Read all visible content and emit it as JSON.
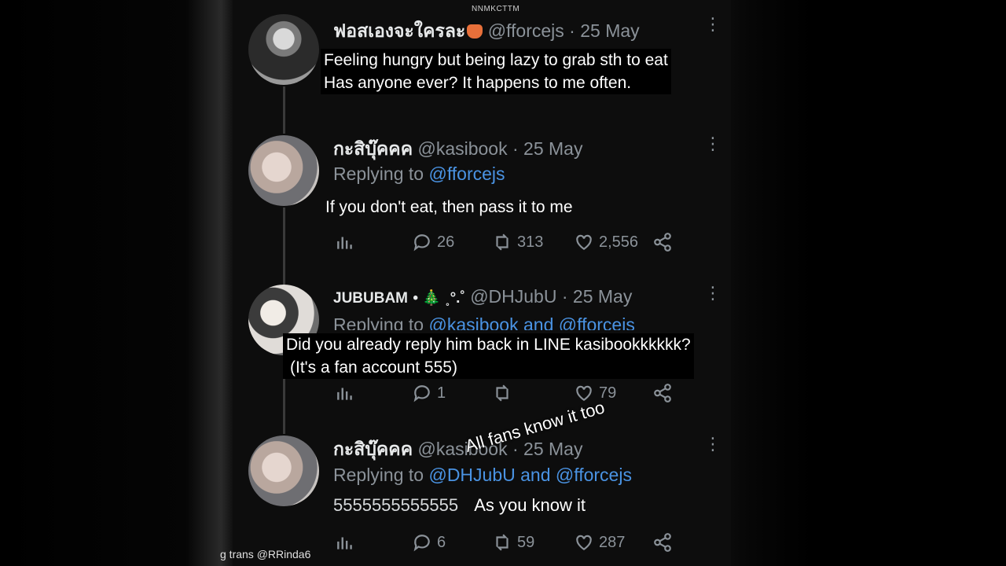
{
  "watermark": "NNMKCTTM",
  "credit": "g trans @RRinda6",
  "tweets": [
    {
      "name": "ฟอสเองจะใครละ",
      "handle": "@fforcejs",
      "date": "25 May",
      "avatar_icon": "profile-photo",
      "translation_line1": "Feeling hungry but being lazy to grab sth to eat",
      "translation_line2": "Has anyone ever? It happens to me often."
    },
    {
      "name": "กะสิบุ๊คคค",
      "handle": "@kasibook",
      "date": "25 May",
      "replying_prefix": "Replying to",
      "replying_to": "@fforcejs",
      "body": "If you don't eat, then pass it to me",
      "stats": {
        "replies": "26",
        "retweets": "313",
        "likes": "2,556"
      }
    },
    {
      "name": "JUBUBAM",
      "name_suffix": "• 🎄 ˳°.˚",
      "handle": "@DHJubU",
      "date": "25 May",
      "replying_prefix": "Replying to",
      "replying_to": "@kasibook and @fforcejs",
      "translation_line1": "Did you already reply him back in LINE kasibookkkkkk?",
      "translation_line2": "(It's a fan account 555)",
      "stats": {
        "replies": "1",
        "likes": "79"
      }
    },
    {
      "name": "กะสิบุ๊คคค",
      "handle": "@kasibook",
      "date": "25 May",
      "replying_prefix": "Replying to",
      "replying_to": "@DHJubU and @fforcejs",
      "body": "5555555555555",
      "translation": "As you know it",
      "stats": {
        "replies": "6",
        "retweets": "59",
        "likes": "287"
      }
    }
  ],
  "sticker_text": "All fans know it too",
  "colors": {
    "mention": "#4a93e3",
    "muted": "#8b9299",
    "background": "#0d0d0d"
  }
}
